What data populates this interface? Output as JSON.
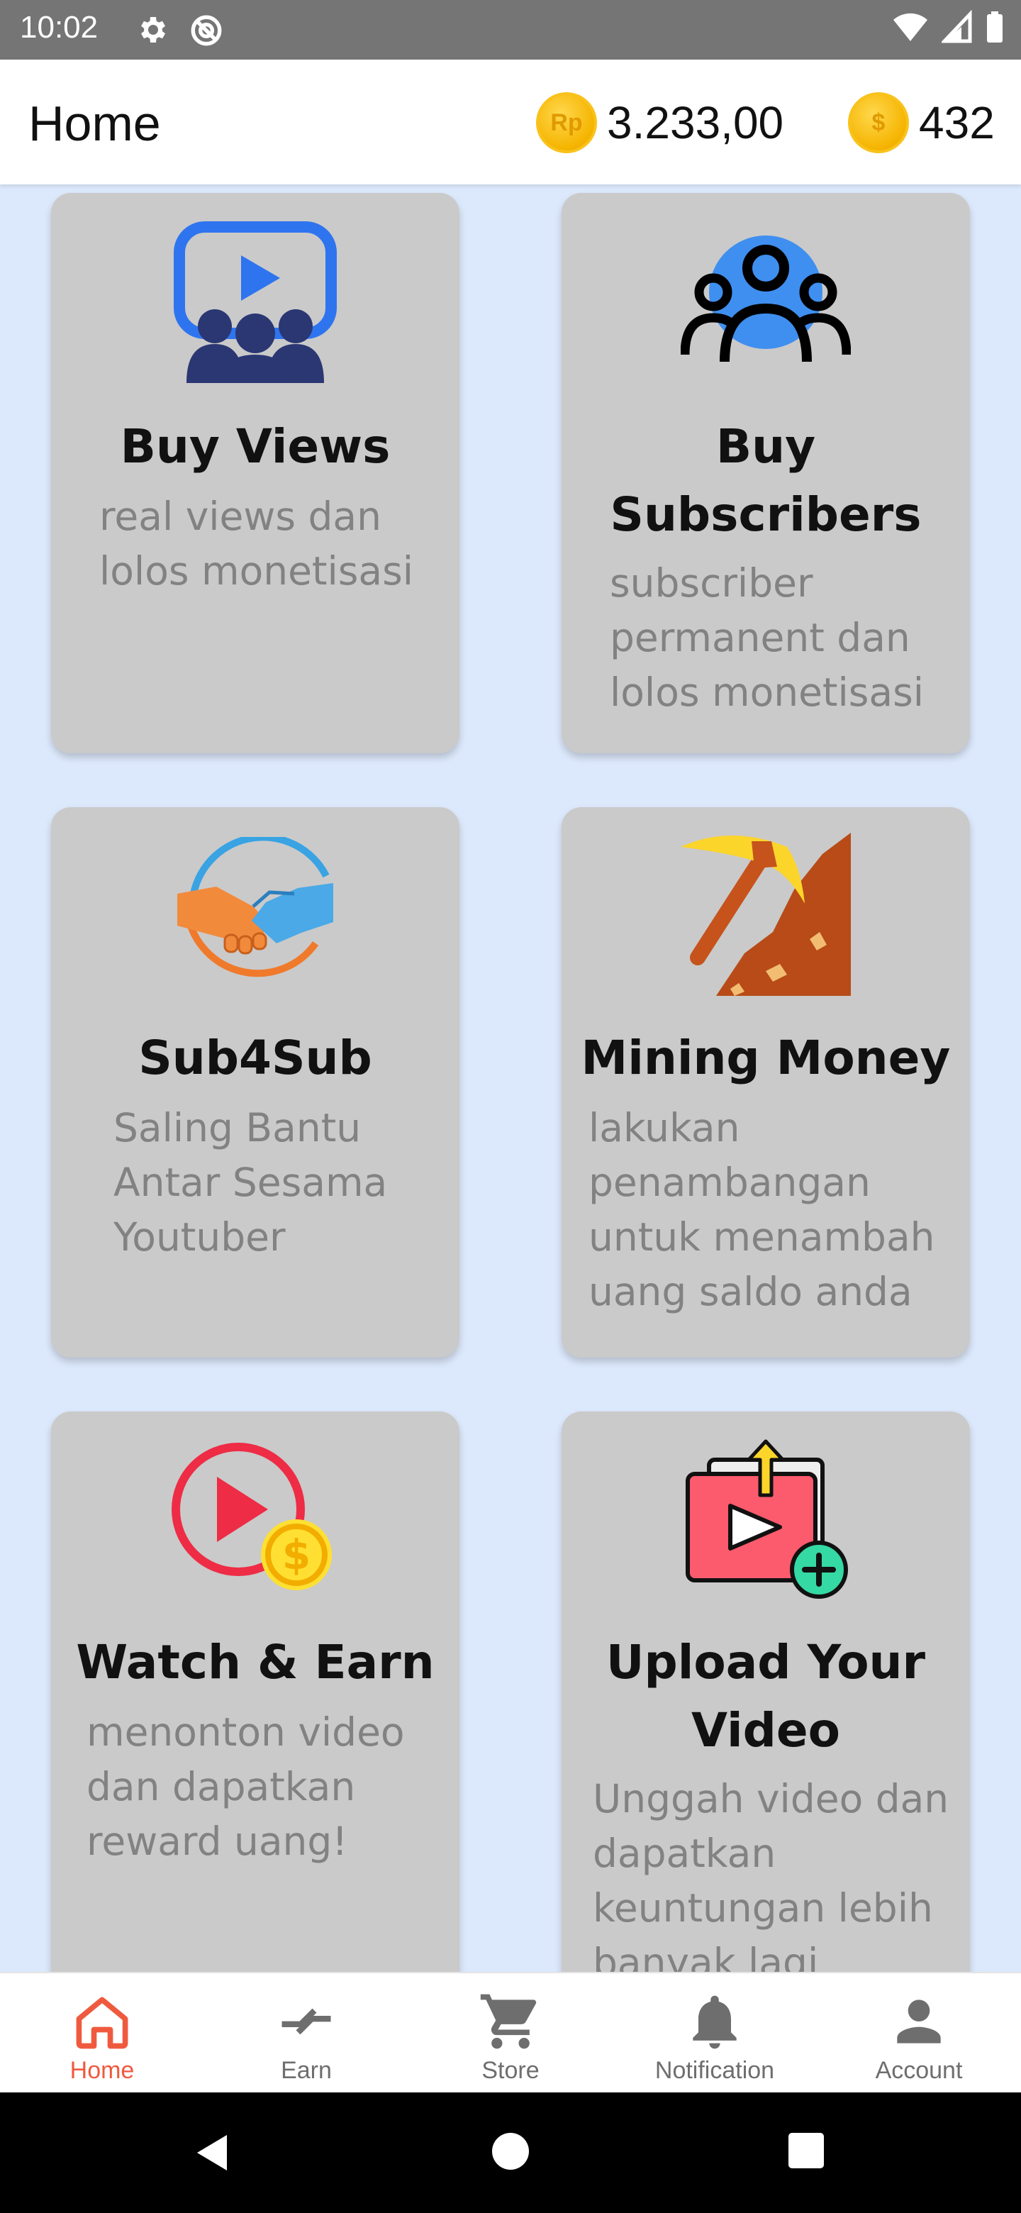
{
  "status_bar": {
    "time": "10:02"
  },
  "app_bar": {
    "title": "Home",
    "rp_symbol": "Rp",
    "rp_balance": "3.233,00",
    "coin_symbol": "$",
    "coin_balance": "432"
  },
  "cards": [
    {
      "title": "Buy Views",
      "desc": "real views dan lolos monetisasi",
      "icon": "video-audience-icon"
    },
    {
      "title": "Buy Subscribers",
      "desc": "subscriber permanent dan lolos monetisasi",
      "icon": "subscribers-group-icon"
    },
    {
      "title": "Sub4Sub",
      "desc": "Saling Bantu Antar Sesama Youtuber",
      "icon": "handshake-icon"
    },
    {
      "title": "Mining Money",
      "desc": "lakukan penambangan untuk menambah uang saldo anda",
      "icon": "pickaxe-mining-icon"
    },
    {
      "title": "Watch & Earn",
      "desc": "menonton video dan dapatkan reward uang!",
      "icon": "play-coin-icon"
    },
    {
      "title": "Upload Your Video",
      "desc": "Unggah video dan dapatkan keuntungan lebih banyak lagi",
      "icon": "upload-video-icon"
    }
  ],
  "bottom_nav": [
    {
      "label": "Home",
      "icon": "home-icon",
      "active": true
    },
    {
      "label": "Earn",
      "icon": "swap-arrows-icon"
    },
    {
      "label": "Store",
      "icon": "cart-icon"
    },
    {
      "label": "Notification",
      "icon": "bell-icon"
    },
    {
      "label": "Account",
      "icon": "person-icon"
    }
  ],
  "colors": {
    "active": "#ef5a3f",
    "inactive": "#6e6e6e",
    "background": "#dce8fb",
    "card": "#cacaca"
  }
}
